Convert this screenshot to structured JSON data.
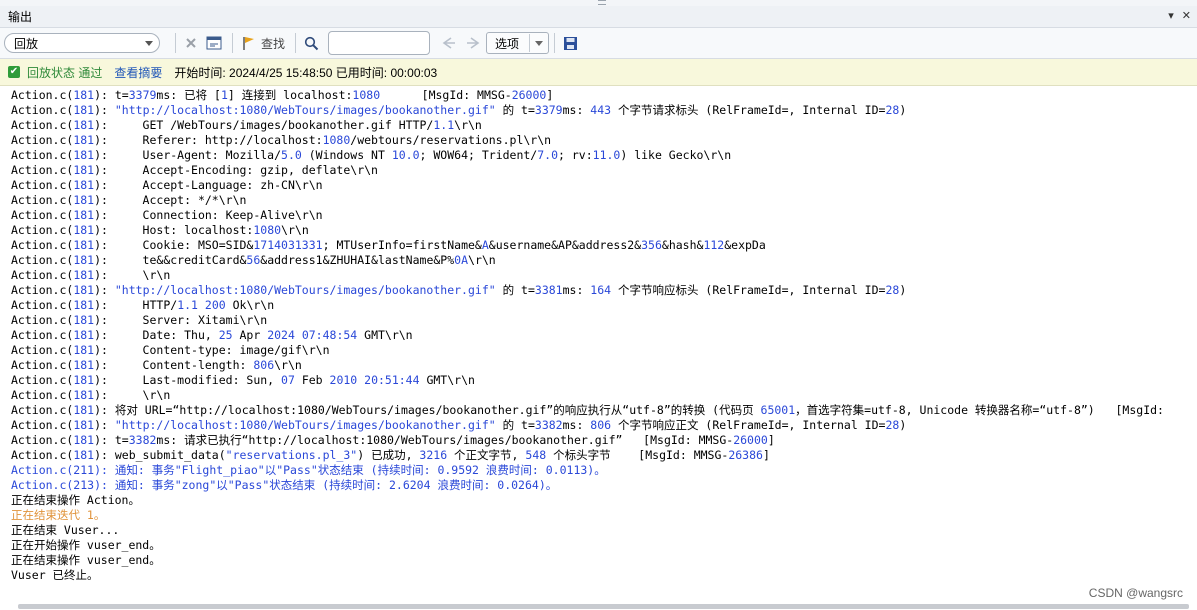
{
  "panel": {
    "title": "输出",
    "pin_glyph": "▾",
    "close_glyph": "✕"
  },
  "toolbar": {
    "mode_value": "回放",
    "find_label": "查找",
    "search_value": "",
    "options_label": "选项"
  },
  "status": {
    "state": "回放状态 通过",
    "summary_link": "查看摘要",
    "timing": "开始时间: 2024/4/25 15:48:50 已用时间: 00:00:03"
  },
  "log_lines": [
    {
      "cls": "",
      "parts": [
        [
          "",
          "Action.c("
        ],
        [
          "n",
          "181"
        ],
        [
          "",
          "): t="
        ],
        [
          "n",
          "3379"
        ],
        [
          "",
          "ms: 已将 ["
        ],
        [
          "n",
          "1"
        ],
        [
          "",
          "] 连接到 localhost:"
        ],
        [
          "n",
          "1080"
        ],
        [
          "",
          "      [MsgId: MMSG-"
        ],
        [
          "n",
          "26000"
        ],
        [
          "",
          "]"
        ]
      ]
    },
    {
      "cls": "",
      "parts": [
        [
          "",
          "Action.c("
        ],
        [
          "n",
          "181"
        ],
        [
          "",
          "): "
        ],
        [
          "s",
          "\"http://localhost:1080/WebTours/images/bookanother.gif\""
        ],
        [
          "",
          " 的 t="
        ],
        [
          "n",
          "3379"
        ],
        [
          "",
          "ms: "
        ],
        [
          "n",
          "443"
        ],
        [
          "",
          " 个字节请求标头 (RelFrameId=, Internal ID="
        ],
        [
          "n",
          "28"
        ],
        [
          "",
          ")"
        ]
      ]
    },
    {
      "cls": "",
      "parts": [
        [
          "",
          "Action.c("
        ],
        [
          "n",
          "181"
        ],
        [
          "",
          "):     GET /WebTours/images/bookanother.gif HTTP/"
        ],
        [
          "n",
          "1.1"
        ],
        [
          "",
          "\\r\\n"
        ]
      ]
    },
    {
      "cls": "",
      "parts": [
        [
          "",
          "Action.c("
        ],
        [
          "n",
          "181"
        ],
        [
          "",
          "):     Referer: http://localhost:"
        ],
        [
          "n",
          "1080"
        ],
        [
          "",
          "/webtours/reservations.pl\\r\\n"
        ]
      ]
    },
    {
      "cls": "",
      "parts": [
        [
          "",
          "Action.c("
        ],
        [
          "n",
          "181"
        ],
        [
          "",
          "):     User-Agent: Mozilla/"
        ],
        [
          "n",
          "5.0"
        ],
        [
          "",
          " (Windows NT "
        ],
        [
          "n",
          "10.0"
        ],
        [
          "",
          "; WOW64; Trident/"
        ],
        [
          "n",
          "7.0"
        ],
        [
          "",
          "; rv:"
        ],
        [
          "n",
          "11.0"
        ],
        [
          "",
          ") like Gecko\\r\\n"
        ]
      ]
    },
    {
      "cls": "",
      "parts": [
        [
          "",
          "Action.c("
        ],
        [
          "n",
          "181"
        ],
        [
          "",
          "):     Accept-Encoding: gzip, deflate\\r\\n"
        ]
      ]
    },
    {
      "cls": "",
      "parts": [
        [
          "",
          "Action.c("
        ],
        [
          "n",
          "181"
        ],
        [
          "",
          "):     Accept-Language: zh-CN\\r\\n"
        ]
      ]
    },
    {
      "cls": "",
      "parts": [
        [
          "",
          "Action.c("
        ],
        [
          "n",
          "181"
        ],
        [
          "",
          "):     Accept: */*\\r\\n"
        ]
      ]
    },
    {
      "cls": "",
      "parts": [
        [
          "",
          "Action.c("
        ],
        [
          "n",
          "181"
        ],
        [
          "",
          "):     Connection: Keep-Alive\\r\\n"
        ]
      ]
    },
    {
      "cls": "",
      "parts": [
        [
          "",
          "Action.c("
        ],
        [
          "n",
          "181"
        ],
        [
          "",
          "):     Host: localhost:"
        ],
        [
          "n",
          "1080"
        ],
        [
          "",
          "\\r\\n"
        ]
      ]
    },
    {
      "cls": "",
      "parts": [
        [
          "",
          "Action.c("
        ],
        [
          "n",
          "181"
        ],
        [
          "",
          "):     Cookie: MSO=SID&"
        ],
        [
          "n",
          "1714031331"
        ],
        [
          "",
          "; MTUserInfo=firstName&"
        ],
        [
          "n",
          "A"
        ],
        [
          "",
          "&username&AP&address2&"
        ],
        [
          "n",
          "356"
        ],
        [
          "",
          "&hash&"
        ],
        [
          "n",
          "112"
        ],
        [
          "",
          "&expDa"
        ]
      ]
    },
    {
      "cls": "",
      "parts": [
        [
          "",
          "Action.c("
        ],
        [
          "n",
          "181"
        ],
        [
          "",
          "):     te&&creditCard&"
        ],
        [
          "n",
          "56"
        ],
        [
          "",
          "&address1&ZHUHAI&lastName&P%"
        ],
        [
          "n",
          "0A"
        ],
        [
          "",
          "\\r\\n"
        ]
      ]
    },
    {
      "cls": "",
      "parts": [
        [
          "",
          "Action.c("
        ],
        [
          "n",
          "181"
        ],
        [
          "",
          "):     \\r\\n"
        ]
      ]
    },
    {
      "cls": "",
      "parts": [
        [
          "",
          "Action.c("
        ],
        [
          "n",
          "181"
        ],
        [
          "",
          "): "
        ],
        [
          "s",
          "\"http://localhost:1080/WebTours/images/bookanother.gif\""
        ],
        [
          "",
          " 的 t="
        ],
        [
          "n",
          "3381"
        ],
        [
          "",
          "ms: "
        ],
        [
          "n",
          "164"
        ],
        [
          "",
          " 个字节响应标头 (RelFrameId=, Internal ID="
        ],
        [
          "n",
          "28"
        ],
        [
          "",
          ")"
        ]
      ]
    },
    {
      "cls": "",
      "parts": [
        [
          "",
          "Action.c("
        ],
        [
          "n",
          "181"
        ],
        [
          "",
          "):     HTTP/"
        ],
        [
          "n",
          "1.1"
        ],
        [
          "",
          ""
        ],
        [
          "n",
          " 200"
        ],
        [
          "",
          " Ok\\r\\n"
        ]
      ]
    },
    {
      "cls": "",
      "parts": [
        [
          "",
          "Action.c("
        ],
        [
          "n",
          "181"
        ],
        [
          "",
          "):     Server: Xitami\\r\\n"
        ]
      ]
    },
    {
      "cls": "",
      "parts": [
        [
          "",
          "Action.c("
        ],
        [
          "n",
          "181"
        ],
        [
          "",
          "):     Date: Thu, "
        ],
        [
          "n",
          "25"
        ],
        [
          "",
          " Apr "
        ],
        [
          "n",
          "2024"
        ],
        [
          "",
          ""
        ],
        [
          "n",
          " 07:48:54"
        ],
        [
          "",
          " GMT\\r\\n"
        ]
      ]
    },
    {
      "cls": "",
      "parts": [
        [
          "",
          "Action.c("
        ],
        [
          "n",
          "181"
        ],
        [
          "",
          "):     Content-type: image/gif\\r\\n"
        ]
      ]
    },
    {
      "cls": "",
      "parts": [
        [
          "",
          "Action.c("
        ],
        [
          "n",
          "181"
        ],
        [
          "",
          "):     Content-length: "
        ],
        [
          "n",
          "806"
        ],
        [
          "",
          "\\r\\n"
        ]
      ]
    },
    {
      "cls": "",
      "parts": [
        [
          "",
          "Action.c("
        ],
        [
          "n",
          "181"
        ],
        [
          "",
          "):     Last-modified: Sun, "
        ],
        [
          "n",
          "07"
        ],
        [
          "",
          " Feb "
        ],
        [
          "n",
          "2010"
        ],
        [
          "",
          ""
        ],
        [
          "n",
          " 20:51:44"
        ],
        [
          "",
          " GMT\\r\\n"
        ]
      ]
    },
    {
      "cls": "",
      "parts": [
        [
          "",
          "Action.c("
        ],
        [
          "n",
          "181"
        ],
        [
          "",
          "):     \\r\\n"
        ]
      ]
    },
    {
      "cls": "",
      "parts": [
        [
          "",
          "Action.c("
        ],
        [
          "n",
          "181"
        ],
        [
          "",
          "): 将对 URL=“http://localhost:1080/WebTours/images/bookanother.gif”的响应执行从“utf-8”的转换 (代码页 "
        ],
        [
          "n",
          "65001"
        ],
        [
          "",
          "，首选字符集=utf-8, Unicode 转换器名称=“utf-8”)   [MsgId:"
        ]
      ]
    },
    {
      "cls": "",
      "parts": [
        [
          "",
          "Action.c("
        ],
        [
          "n",
          "181"
        ],
        [
          "",
          "): "
        ],
        [
          "s",
          "\"http://localhost:1080/WebTours/images/bookanother.gif\""
        ],
        [
          "",
          " 的 t="
        ],
        [
          "n",
          "3382"
        ],
        [
          "",
          "ms: "
        ],
        [
          "n",
          "806"
        ],
        [
          "",
          " 个字节响应正文 (RelFrameId=, Internal ID="
        ],
        [
          "n",
          "28"
        ],
        [
          "",
          ")"
        ]
      ]
    },
    {
      "cls": "",
      "parts": [
        [
          "",
          "Action.c("
        ],
        [
          "n",
          "181"
        ],
        [
          "",
          "): t="
        ],
        [
          "n",
          "3382"
        ],
        [
          "",
          "ms: 请求已执行“http://localhost:1080/WebTours/images/bookanother.gif”   [MsgId: MMSG-"
        ],
        [
          "n",
          "26000"
        ],
        [
          "",
          "]"
        ]
      ]
    },
    {
      "cls": "",
      "parts": [
        [
          "",
          "Action.c("
        ],
        [
          "n",
          "181"
        ],
        [
          "",
          "): web_submit_data("
        ],
        [
          "s",
          "\"reservations.pl_3\""
        ],
        [
          "",
          ") 已成功, "
        ],
        [
          "n",
          "3216"
        ],
        [
          "",
          " 个正文字节, "
        ],
        [
          "n",
          "548"
        ],
        [
          "",
          " 个标头字节    [MsgId: MMSG-"
        ],
        [
          "n",
          "26386"
        ],
        [
          "",
          "]"
        ]
      ]
    },
    {
      "cls": "blue",
      "parts": [
        [
          "",
          "Action.c(211): 通知: 事务\"Flight_piao\"以\"Pass\"状态结束 (持续时间: 0.9592 浪费时间: 0.0113)。"
        ]
      ]
    },
    {
      "cls": "blue",
      "parts": [
        [
          "",
          "Action.c(213): 通知: 事务\"zong\"以\"Pass\"状态结束 (持续时间: 2.6204 浪费时间: 0.0264)。"
        ]
      ]
    },
    {
      "cls": "",
      "parts": [
        [
          "",
          "正在结束操作 Action。"
        ]
      ]
    },
    {
      "cls": "orange",
      "parts": [
        [
          "",
          "正在结束迭代 1。"
        ]
      ]
    },
    {
      "cls": "",
      "parts": [
        [
          "",
          "正在结束 Vuser..."
        ]
      ]
    },
    {
      "cls": "",
      "parts": [
        [
          "",
          "正在开始操作 vuser_end。"
        ]
      ]
    },
    {
      "cls": "",
      "parts": [
        [
          "",
          "正在结束操作 vuser_end。"
        ]
      ]
    },
    {
      "cls": "",
      "parts": [
        [
          "",
          "Vuser 已终止。"
        ]
      ]
    }
  ],
  "watermark": "CSDN @wangsrc",
  "colors": {
    "number": "#2a48d8",
    "string": "#2a48d8",
    "notice": "#2a48d8",
    "iteration": "#e0933a",
    "pass": "#2f8a3a"
  }
}
